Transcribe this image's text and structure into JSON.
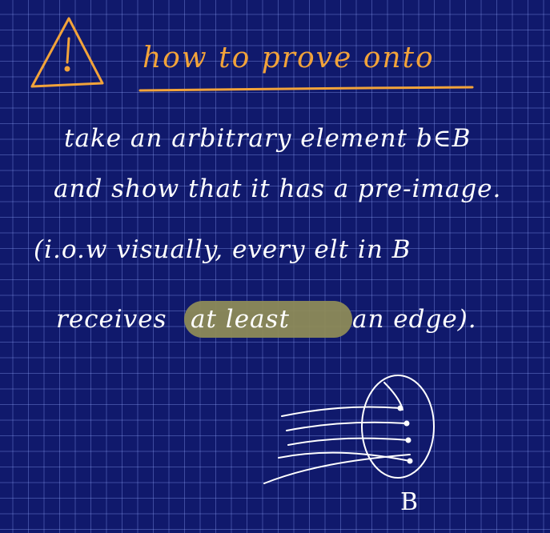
{
  "title": "how to prove onto",
  "lines": [
    "take an arbitrary element b∈B",
    "and show that it has a pre-image.",
    "(i.o.w visually, every elt in B",
    "receives",
    "at least",
    "an edge)."
  ],
  "diagram_label": "B",
  "colors": {
    "background": "#10196c",
    "grid": "#96aaff",
    "title": "#f2a33a",
    "ink": "#ffffff",
    "highlight": "#8d8a58"
  },
  "icons": [
    "warning-triangle-icon"
  ]
}
